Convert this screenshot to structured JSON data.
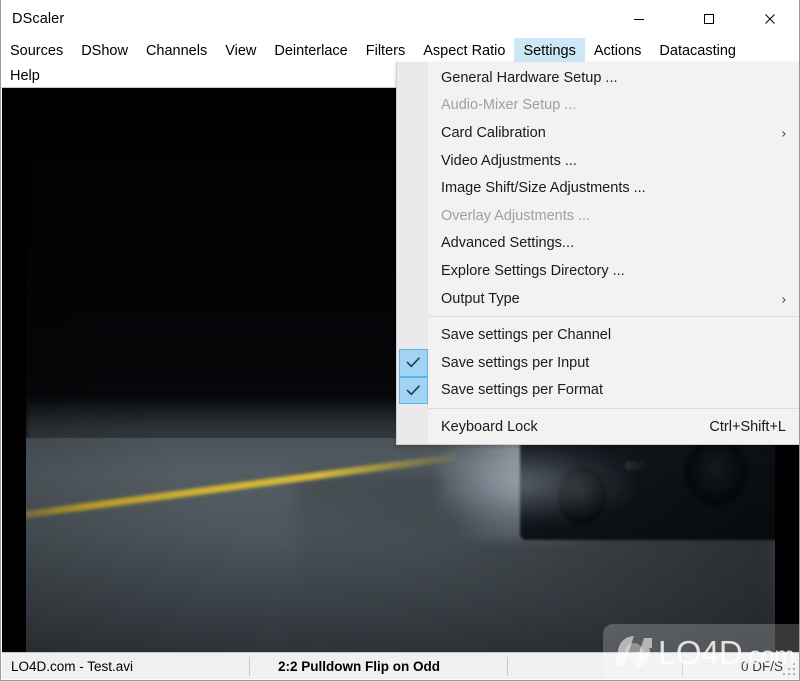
{
  "window": {
    "title": "DScaler",
    "controls": {
      "minimize": "minimize-button",
      "maximize": "maximize-button",
      "close": "close-button"
    }
  },
  "menubar": {
    "row1": [
      {
        "label": "Sources",
        "active": false
      },
      {
        "label": "DShow",
        "active": false
      },
      {
        "label": "Channels",
        "active": false
      },
      {
        "label": "View",
        "active": false
      },
      {
        "label": "Deinterlace",
        "active": false
      },
      {
        "label": "Filters",
        "active": false
      },
      {
        "label": "Aspect Ratio",
        "active": false
      },
      {
        "label": "Settings",
        "active": true
      },
      {
        "label": "Actions",
        "active": false
      },
      {
        "label": "Datacasting",
        "active": false
      }
    ],
    "row2": [
      {
        "label": "Help",
        "active": false
      }
    ]
  },
  "dropdown": {
    "owner": "Settings",
    "highlight_color": "#cce8f7",
    "check_color": "#9fd5f2",
    "items": [
      {
        "label": "General Hardware Setup ...",
        "disabled": false,
        "checked": false,
        "submenu": false,
        "accel": ""
      },
      {
        "label": "Audio-Mixer Setup ...",
        "disabled": true,
        "checked": false,
        "submenu": false,
        "accel": ""
      },
      {
        "label": "Card Calibration",
        "disabled": false,
        "checked": false,
        "submenu": true,
        "accel": ""
      },
      {
        "label": "Video Adjustments ...",
        "disabled": false,
        "checked": false,
        "submenu": false,
        "accel": ""
      },
      {
        "label": "Image Shift/Size Adjustments ...",
        "disabled": false,
        "checked": false,
        "submenu": false,
        "accel": ""
      },
      {
        "label": "Overlay Adjustments ...",
        "disabled": true,
        "checked": false,
        "submenu": false,
        "accel": ""
      },
      {
        "label": "Advanced Settings...",
        "disabled": false,
        "checked": false,
        "submenu": false,
        "accel": ""
      },
      {
        "label": "Explore Settings Directory ...",
        "disabled": false,
        "checked": false,
        "submenu": false,
        "accel": ""
      },
      {
        "label": "Output Type",
        "disabled": false,
        "checked": false,
        "submenu": true,
        "accel": ""
      },
      {
        "separator": true
      },
      {
        "label": "Save settings per Channel",
        "disabled": false,
        "checked": false,
        "submenu": false,
        "accel": ""
      },
      {
        "label": "Save settings per Input",
        "disabled": false,
        "checked": true,
        "submenu": false,
        "accel": ""
      },
      {
        "label": "Save settings per Format",
        "disabled": false,
        "checked": true,
        "submenu": false,
        "accel": ""
      },
      {
        "separator": true
      },
      {
        "label": "Keyboard Lock",
        "disabled": false,
        "checked": false,
        "submenu": false,
        "accel": "Ctrl+Shift+L"
      }
    ]
  },
  "video": {
    "description": "night-road-car-video-frame",
    "letterbox_color": "#000000"
  },
  "statusbar": {
    "file": "LO4D.com - Test.avi",
    "mode": "2:2 Pulldown Flip on Odd",
    "blank": "",
    "fps": "0 DF/S"
  },
  "watermark": {
    "text": "LO4D",
    "suffix": ".com"
  }
}
